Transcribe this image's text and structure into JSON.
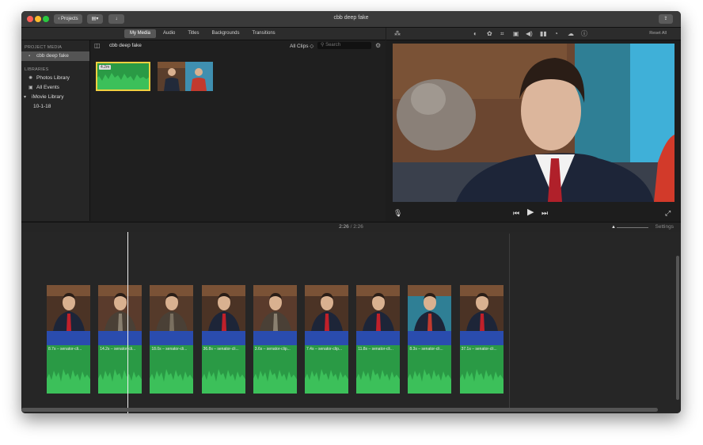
{
  "window": {
    "title": "cbb deep fake"
  },
  "toolbar": {
    "projects_label": "Projects",
    "import_label": "↓",
    "share_icon": "share-icon"
  },
  "tabs": [
    {
      "label": "My Media",
      "active": true
    },
    {
      "label": "Audio",
      "active": false
    },
    {
      "label": "Titles",
      "active": false
    },
    {
      "label": "Backgrounds",
      "active": false
    },
    {
      "label": "Transitions",
      "active": false
    }
  ],
  "viewer_toolbar": {
    "reset_label": "Reset All"
  },
  "sidebar": {
    "project_media_heading": "PROJECT MEDIA",
    "project_item": "cbb deep fake",
    "libraries_heading": "LIBRARIES",
    "library_items": [
      {
        "label": "Photos Library",
        "icon": "photos-icon"
      },
      {
        "label": "All Events",
        "icon": "star-icon"
      },
      {
        "label": "iMovie Library",
        "icon": "disclosure-icon"
      },
      {
        "label": "10-1-18",
        "icon": ""
      }
    ]
  },
  "browser": {
    "title": "cbb deep fake",
    "filter": "All Clips ◇",
    "search_placeholder": "Search",
    "audio_clip_duration": "4.2m"
  },
  "timeline": {
    "current_time": "2:26",
    "separator": "/",
    "total_time": "2:26",
    "settings_label": "Settings",
    "clips": [
      {
        "label": "8.7s – senator-cli..."
      },
      {
        "label": "14.2s – senator-cli..."
      },
      {
        "label": "18.0s – senator-cli..."
      },
      {
        "label": "36.8s – senator-cli..."
      },
      {
        "label": "3.6s – senator-clip..."
      },
      {
        "label": "7.4s – senator-clip..."
      },
      {
        "label": "11.8s – senator-cli..."
      },
      {
        "label": "8.3s – senator-cli..."
      },
      {
        "label": "37.1s – senator-cli..."
      }
    ]
  },
  "colors": {
    "audio_green": "#2a9a45",
    "video_blue": "#2a4cae",
    "selection_yellow": "#f0d040"
  }
}
